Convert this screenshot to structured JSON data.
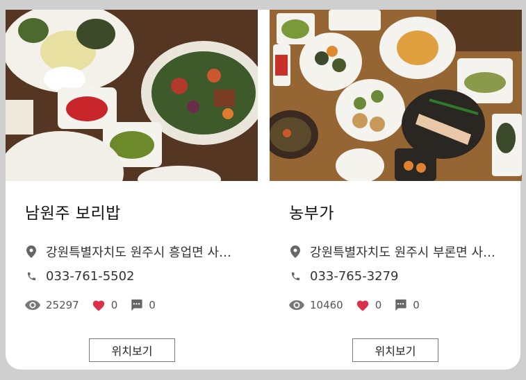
{
  "restaurants": [
    {
      "name": "남원주 보리밥",
      "address": "강원특별자치도 원주시 흥업면 사…",
      "phone": "033-761-5502",
      "views": "25297",
      "likes": "0",
      "comments": "0",
      "button_label": "위치보기"
    },
    {
      "name": "농부가",
      "address": "강원특별자치도 원주시 부론면 사…",
      "phone": "033-765-3279",
      "views": "10460",
      "likes": "0",
      "comments": "0",
      "button_label": "위치보기"
    }
  ],
  "colors": {
    "heart": "#d9304c",
    "icon_gray": "#666666",
    "page_bg": "#cfcfcf"
  }
}
